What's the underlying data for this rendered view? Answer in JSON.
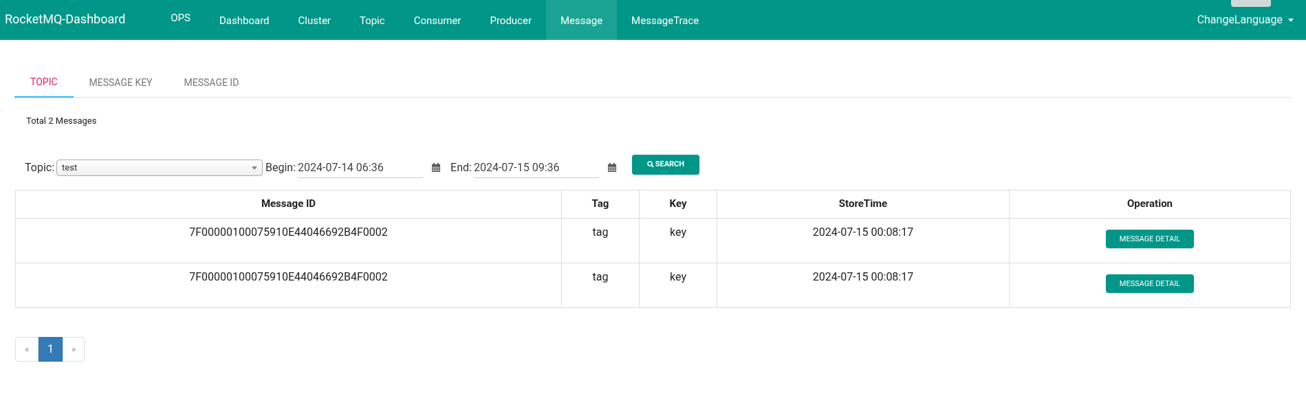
{
  "navbar": {
    "brand": "RocketMQ-Dashboard",
    "items": [
      {
        "label": "OPS",
        "selected": false
      },
      {
        "label": "Dashboard",
        "selected": false
      },
      {
        "label": "Cluster",
        "selected": false
      },
      {
        "label": "Topic",
        "selected": false
      },
      {
        "label": "Consumer",
        "selected": false
      },
      {
        "label": "Producer",
        "selected": false
      },
      {
        "label": "Message",
        "selected": true
      },
      {
        "label": "MessageTrace",
        "selected": false
      }
    ],
    "language_menu": "ChangeLanguage"
  },
  "tabs": [
    {
      "label": "TOPIC",
      "selected": true
    },
    {
      "label": "MESSAGE KEY",
      "selected": false
    },
    {
      "label": "MESSAGE ID",
      "selected": false
    }
  ],
  "summary": "Total 2 Messages",
  "filters": {
    "topic_label": "Topic:",
    "topic_value": "test",
    "begin_label": "Begin:",
    "begin_value": "2024-07-14 06:36",
    "end_label": "End:",
    "end_value": "2024-07-15 09:36",
    "search_button": "SEARCH"
  },
  "table": {
    "columns": [
      "Message ID",
      "Tag",
      "Key",
      "StoreTime",
      "Operation"
    ],
    "rows": [
      {
        "message_id": "7F00000100075910E44046692B4F0002",
        "tag": "tag",
        "key": "key",
        "store_time": "2024-07-15 00:08:17",
        "action": "MESSAGE DETAIL"
      },
      {
        "message_id": "7F00000100075910E44046692B4F0002",
        "tag": "tag",
        "key": "key",
        "store_time": "2024-07-15 00:08:17",
        "action": "MESSAGE DETAIL"
      }
    ]
  },
  "pagination": {
    "prev": "«",
    "pages": [
      {
        "label": "1",
        "selected": true
      }
    ],
    "next": "»"
  }
}
